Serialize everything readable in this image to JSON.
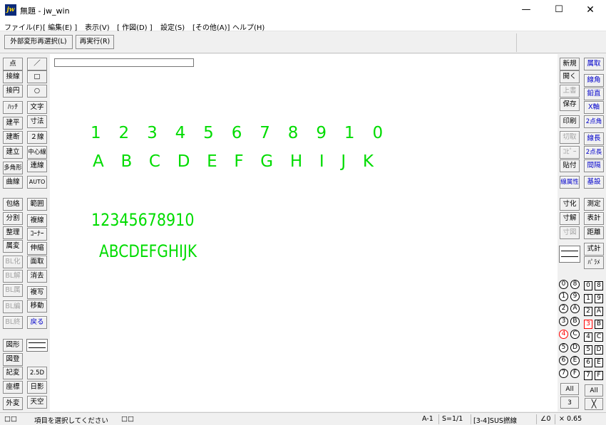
{
  "window": {
    "title": "無題 - jw_win",
    "icon_label": "jw"
  },
  "menu": [
    "ファイル(F)",
    "[ 編集(E) ]",
    "表示(V)",
    "[ 作図(D) ]",
    "設定(S)",
    "[その他(A)]",
    "ヘルプ(H)"
  ],
  "toolbar": {
    "reselect": "外部変形再選択(L)",
    "rerun": "再実行(R)"
  },
  "left_col1": [
    "点",
    "接線",
    "接円",
    "ﾊｯﾁ",
    "建平",
    "建断",
    "建立",
    "多角形",
    "曲線",
    "包絡",
    "分割",
    "整理",
    "属変",
    "BL化",
    "BL解",
    "BL属",
    "BL編",
    "BL終",
    "図形",
    "図登",
    "記変",
    "座標",
    "外変"
  ],
  "left_col2": [
    "／",
    "□",
    "○",
    "文字",
    "寸法",
    "２線",
    "中心線",
    "連線",
    "AUTO",
    "範囲",
    "複線",
    "ｺｰﾅｰ",
    "伸縮",
    "面取",
    "消去",
    "複写",
    "移動",
    "戻る",
    "2.5D",
    "日影",
    "天空"
  ],
  "right_col1": [
    "新規",
    "開く",
    "上書",
    "保存",
    "印刷",
    "切取",
    "ｺﾋﾟｰ",
    "貼付",
    "線属性",
    "寸化",
    "寸解",
    "寸図"
  ],
  "right_col2": [
    "属取",
    "線角",
    "鉛直",
    "X軸",
    "2点角",
    "線長",
    "2点長",
    "間隔",
    "基設",
    "測定",
    "表計",
    "距離",
    "式計",
    "ﾊﾟﾗﾒ"
  ],
  "layer_group_left": [
    "0",
    "1",
    "2",
    "3",
    "4",
    "5",
    "6",
    "7"
  ],
  "layer_group_right": [
    "8",
    "9",
    "A",
    "B",
    "C",
    "D",
    "E",
    "F"
  ],
  "layer_sq_left": [
    "0",
    "1",
    "2",
    "3",
    "4",
    "5",
    "6",
    "7"
  ],
  "layer_sq_right": [
    "8",
    "9",
    "A",
    "B",
    "C",
    "D",
    "E",
    "F"
  ],
  "layer_all_left": "All",
  "layer_all_right": "All",
  "layer_num": "3",
  "layer_x": "╳",
  "canvas_text": {
    "row1": "1 2 3 4 5 6 7 8 9 1 0",
    "row2": "A B C D E F G H I J K",
    "row3": "12345678910",
    "row4": "ABCDEFGHIJK"
  },
  "status": {
    "left_marks": "□□",
    "message": "項目を選択してください",
    "mid_marks": "□□",
    "paper": "A-1",
    "scale": "S=1/1",
    "layer": "[3-4]SUS撚線",
    "angle": "∠0",
    "zoom": "× 0.65"
  },
  "colors": {
    "glyph": "#00dc00",
    "accent_blue": "#0000cc",
    "active_red": "#ff0000"
  }
}
